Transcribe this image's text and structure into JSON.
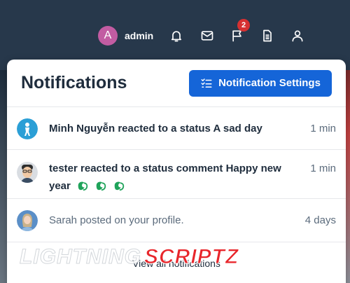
{
  "topbar": {
    "avatar_letter": "A",
    "user_name": "admin",
    "flag_badge": "2",
    "icons": [
      "bell-icon",
      "mail-icon",
      "flag-icon",
      "document-icon",
      "person-icon"
    ]
  },
  "panel": {
    "title": "Notifications",
    "settings_label": "Notification Settings",
    "footer_label": "View all notifications"
  },
  "notifications": [
    {
      "text": "Minh Nguyễn reacted to a status A sad day",
      "time": "1 min"
    },
    {
      "text": "tester reacted to a status comment Happy new year",
      "time": "1 min"
    },
    {
      "text": "Sarah posted on your profile.",
      "time": "4 days"
    }
  ],
  "watermark": {
    "part1": "LIGHTNING",
    "part2": "SCRIPTZ"
  },
  "colors": {
    "topbar_bg": "#27384b",
    "accent": "#1565d8",
    "badge": "#d63031",
    "avatar_a": "#c25ca2",
    "emoji_green": "#1fa35a"
  }
}
